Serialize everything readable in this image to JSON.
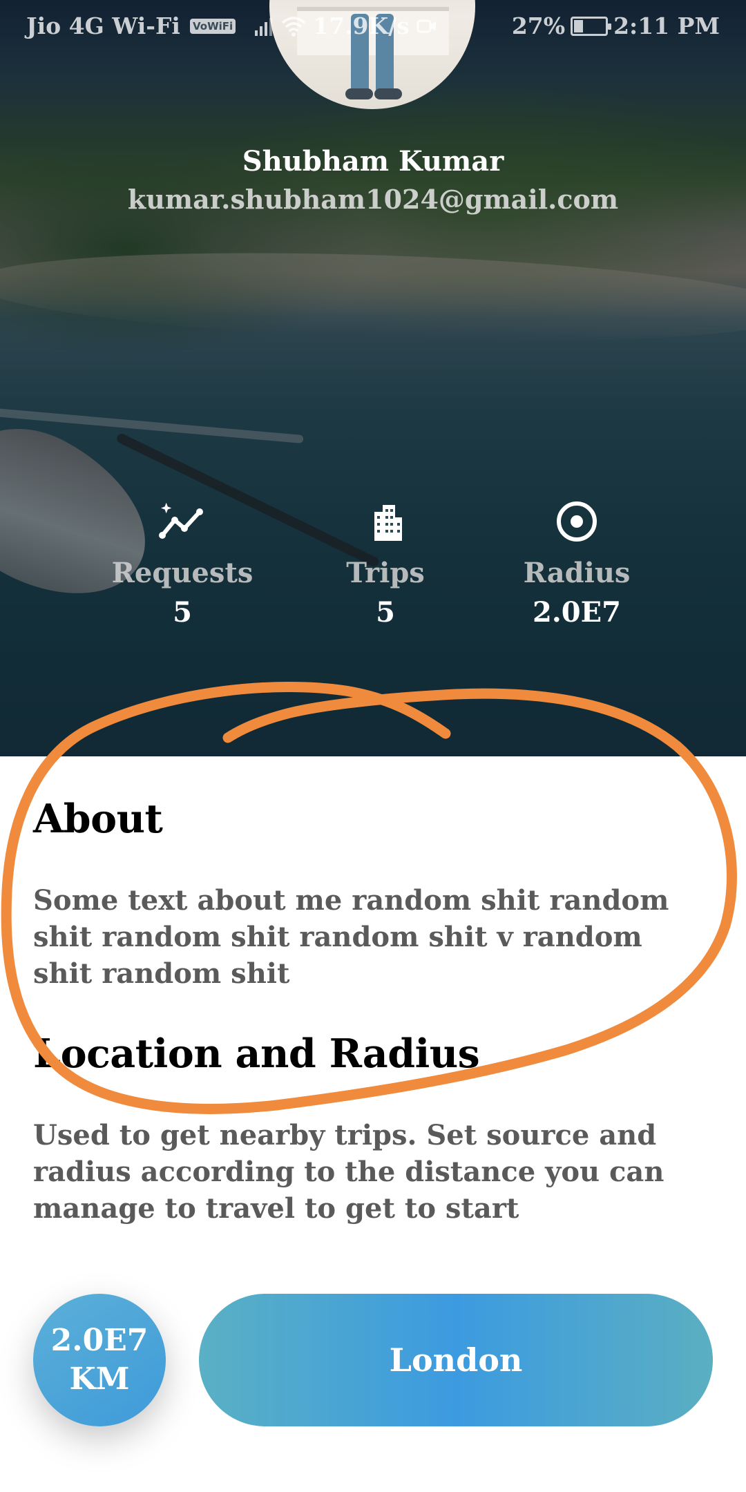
{
  "status_bar": {
    "carrier": "Jio 4G Wi-Fi",
    "vowifi_badge": "VoWiFi",
    "speed": "17.9K/s",
    "battery": "27%",
    "battery_level": 0.27,
    "time": "2:11 PM"
  },
  "profile": {
    "name": "Shubham Kumar",
    "email": "kumar.shubham1024@gmail.com"
  },
  "stats": [
    {
      "label": "Requests",
      "value": "5",
      "icon": "trending-icon"
    },
    {
      "label": "Trips",
      "value": "5",
      "icon": "building-icon"
    },
    {
      "label": "Radius",
      "value": "2.0E7",
      "icon": "target-icon"
    }
  ],
  "about": {
    "title": "About",
    "text": "Some text about me random shit random shit random shit random shit v random shit random shit"
  },
  "location_section": {
    "title": "Location and Radius",
    "text": "Used to get nearby trips. Set source and radius according to the distance you can manage to travel to get to start"
  },
  "controls": {
    "radius_value": "2.0E7",
    "radius_unit": "KM",
    "location": "London"
  },
  "colors": {
    "accent": "#3e9ad9",
    "scribble": "#f08a3c"
  }
}
